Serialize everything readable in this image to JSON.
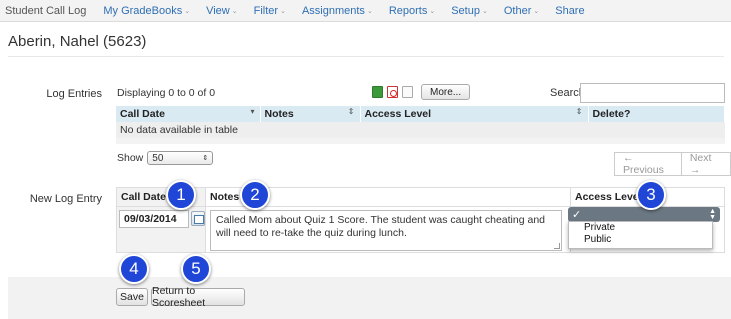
{
  "nav": {
    "app_title": "Student Call Log",
    "items": [
      {
        "label": "My GradeBooks",
        "dropdown": true
      },
      {
        "label": "View",
        "dropdown": true
      },
      {
        "label": "Filter",
        "dropdown": true
      },
      {
        "label": "Assignments",
        "dropdown": true
      },
      {
        "label": "Reports",
        "dropdown": true
      },
      {
        "label": "Setup",
        "dropdown": true
      },
      {
        "label": "Other",
        "dropdown": true
      },
      {
        "label": "Share",
        "dropdown": false
      }
    ],
    "caret": "⌄"
  },
  "page_title": "Aberin, Nahel (5623)",
  "log_entries": {
    "label": "Log Entries",
    "displaying": "Displaying 0 to 0 of 0",
    "more_button": "More...",
    "search_label": "Search",
    "search_value": "",
    "columns": [
      "Call Date",
      "Notes",
      "Access Level",
      "Delete?"
    ],
    "empty_message": "No data available in table",
    "show_label": "Show",
    "page_size": "50",
    "prev_label": "← Previous",
    "next_label": "Next →"
  },
  "new_entry": {
    "label": "New Log Entry",
    "date_header": "Call Date",
    "notes_header": "Notes",
    "access_header": "Access Level",
    "date_value": "09/03/2014",
    "notes_value": "Called Mom about Quiz 1 Score. The student was caught cheating and will need to re-take the quiz during lunch.",
    "access_selected": "✓",
    "access_options": [
      "Private",
      "Public"
    ]
  },
  "buttons": {
    "save": "Save",
    "return": "Return to Scoresheet"
  },
  "callouts": [
    "1",
    "2",
    "3",
    "4",
    "5"
  ],
  "colors": {
    "callout": "#1f46d6",
    "nav_link": "#2f6fb3",
    "table_header": "#d9eaf3"
  }
}
